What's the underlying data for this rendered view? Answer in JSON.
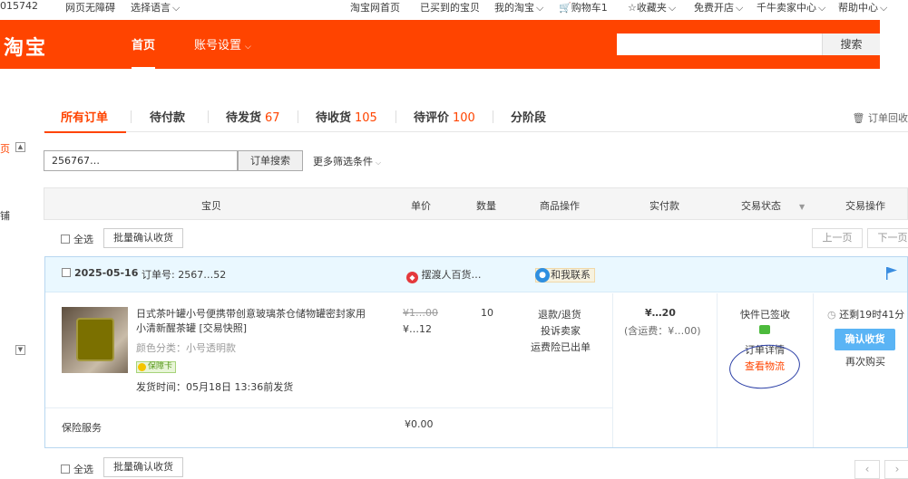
{
  "topbar": {
    "user_id": "015742",
    "accessible": "网页无障碍",
    "language": "选择语言",
    "taobao_home": "淘宝网首页",
    "purchased": "已买到的宝贝",
    "my_taobao": "我的淘宝",
    "cart": "购物车1",
    "favorites": "收藏夹",
    "open_shop": "免费开店",
    "seller_center": "千牛卖家中心",
    "help": "帮助中心"
  },
  "header": {
    "logo": "淘宝",
    "nav_home": "首页",
    "nav_account": "账号设置",
    "search_button": "搜索",
    "search_value": ""
  },
  "left_sidebar": {
    "frag1": "页",
    "frag2": "铺"
  },
  "tabs": [
    {
      "label": "所有订单",
      "count": ""
    },
    {
      "label": "待付款",
      "count": ""
    },
    {
      "label": "待发货",
      "count": "67"
    },
    {
      "label": "待收货",
      "count": "105"
    },
    {
      "label": "待评价",
      "count": "100"
    },
    {
      "label": "分阶段",
      "count": ""
    }
  ],
  "recycle_bin": "订单回收",
  "filter": {
    "order_value": "256767…",
    "search_button": "订单搜索",
    "more_filters": "更多筛选条件"
  },
  "columns": {
    "item": "宝贝",
    "price": "单价",
    "qty": "数量",
    "ops": "商品操作",
    "paid": "实付款",
    "status": "交易状态",
    "trade_ops": "交易操作"
  },
  "bulk": {
    "select_all": "全选",
    "batch_confirm": "批量确认收货",
    "prev_page": "上一页",
    "next_page": "下一页"
  },
  "order": {
    "date": "2025-05-16",
    "order_no_label": "订单号:",
    "order_no": "2567…52",
    "shop_name": "摆渡人百货…",
    "contact": "和我联系",
    "item_title": "日式茶叶罐小号便携带创意玻璃茶仓储物罐密封家用小清新醒茶罐 [交易快照]",
    "item_variant": "颜色分类：小号透明款",
    "guarantee": "保障卡",
    "ship_time": "发货时间：05月18日 13:36前发货",
    "orig_price": "¥1…00",
    "price": "¥…12",
    "quantity": "10",
    "op_refund": "退款/退货",
    "op_complain": "投诉卖家",
    "op_insurance": "运费险已出单",
    "paid": "¥…20",
    "shipping": "(含运费：¥…00)",
    "status": "快件已签收",
    "detail": "订单详情",
    "logistics": "查看物流",
    "countdown": "还剩19时41分",
    "confirm": "确认收货",
    "rebuy": "再次购买",
    "insurance_label": "保险服务",
    "insurance_price": "¥0.00"
  },
  "colors": {
    "brand": "#ff4400",
    "accent": "#f40",
    "confirm_blue": "#5ab4f5"
  }
}
